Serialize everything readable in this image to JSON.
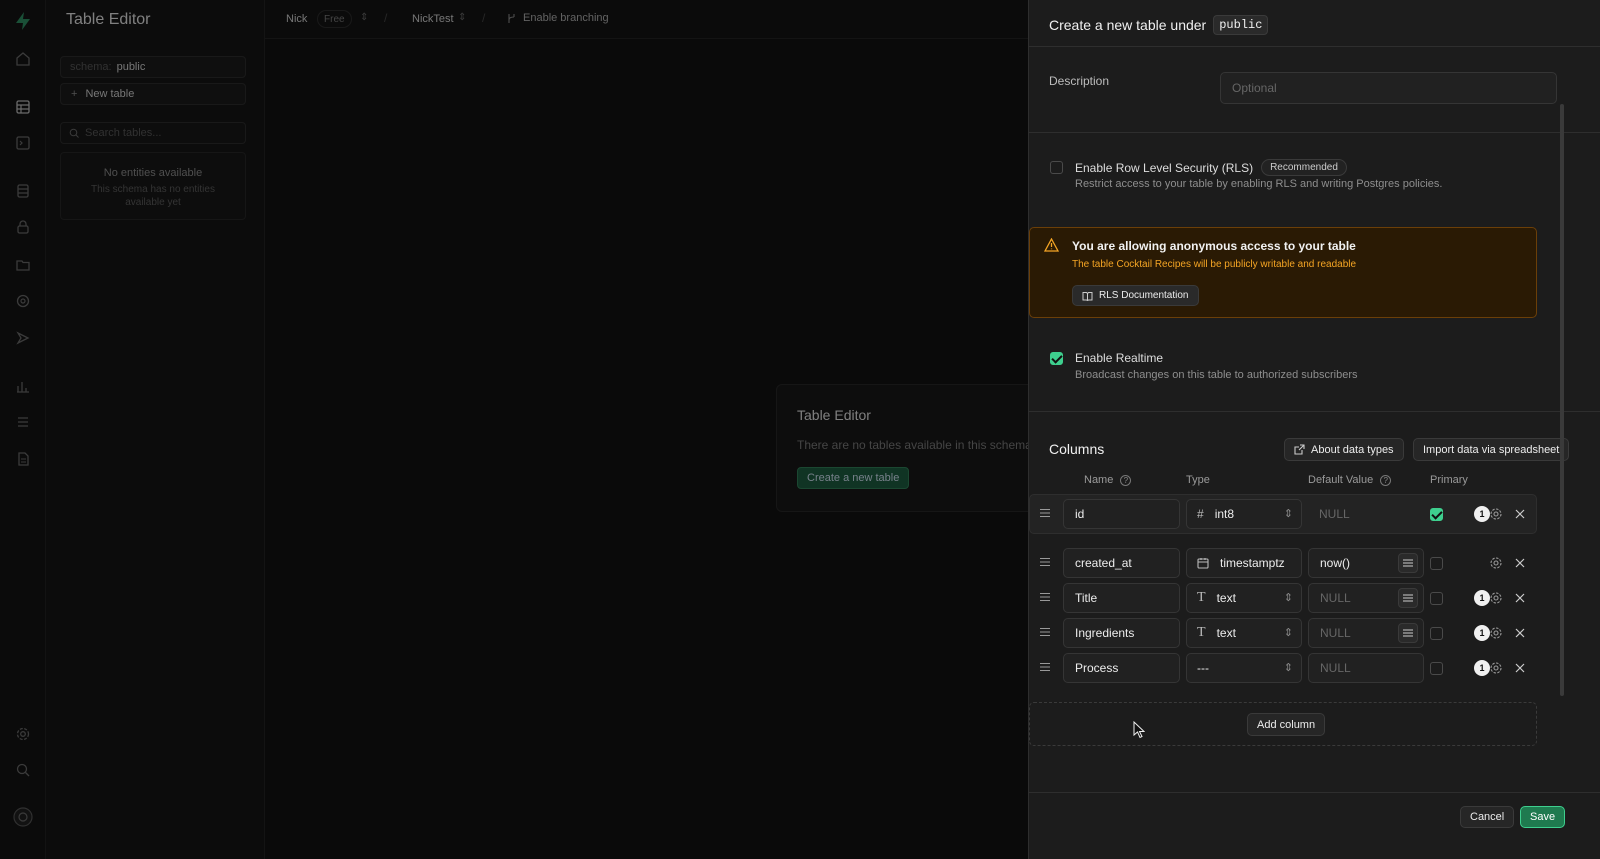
{
  "app": {
    "title": "Table Editor",
    "org": "Nick",
    "plan": "Free",
    "project": "NickTest",
    "branching": "Enable branching"
  },
  "sidebar": {
    "schema_label": "schema:",
    "schema_value": "public",
    "new_table": "New table",
    "search_placeholder": "Search tables...",
    "empty_title": "No entities available",
    "empty_desc": "This schema has no entities available yet"
  },
  "main": {
    "card_title": "Table Editor",
    "card_desc": "There are no tables available in this schema.",
    "card_button": "Create a new table"
  },
  "panel": {
    "title_prefix": "Create a new table under",
    "schema": "public",
    "description_label": "Description",
    "description_placeholder": "Optional",
    "rls": {
      "label": "Enable Row Level Security (RLS)",
      "badge": "Recommended",
      "desc": "Restrict access to your table by enabling RLS and writing Postgres policies."
    },
    "warning": {
      "title": "You are allowing anonymous access to your table",
      "desc": "The table Cocktail Recipes will be publicly writable and readable",
      "button": "RLS Documentation"
    },
    "realtime": {
      "label": "Enable Realtime",
      "desc": "Broadcast changes on this table to authorized subscribers"
    },
    "columns": {
      "title": "Columns",
      "about_button": "About data types",
      "import_button": "Import data via spreadsheet",
      "headers": {
        "name": "Name",
        "type": "Type",
        "default": "Default Value",
        "primary": "Primary"
      },
      "rows": [
        {
          "name": "id",
          "type": "int8",
          "default": "NULL",
          "badge": "1"
        },
        {
          "name": "created_at",
          "type": "timestamptz",
          "default": "now()",
          "badge": ""
        },
        {
          "name": "Title",
          "type": "text",
          "default": "NULL",
          "badge": "1"
        },
        {
          "name": "Ingredients",
          "type": "text",
          "default": "NULL",
          "badge": "1"
        },
        {
          "name": "Process",
          "type": "---",
          "default": "NULL",
          "badge": "1"
        }
      ],
      "add_column": "Add column"
    },
    "footer": {
      "cancel": "Cancel",
      "save": "Save"
    }
  },
  "colors": {
    "accent": "#3ecf8e",
    "warning_bg": "#2a1a04",
    "warning_border": "#6b3f08",
    "warning_text": "#f5a524"
  }
}
